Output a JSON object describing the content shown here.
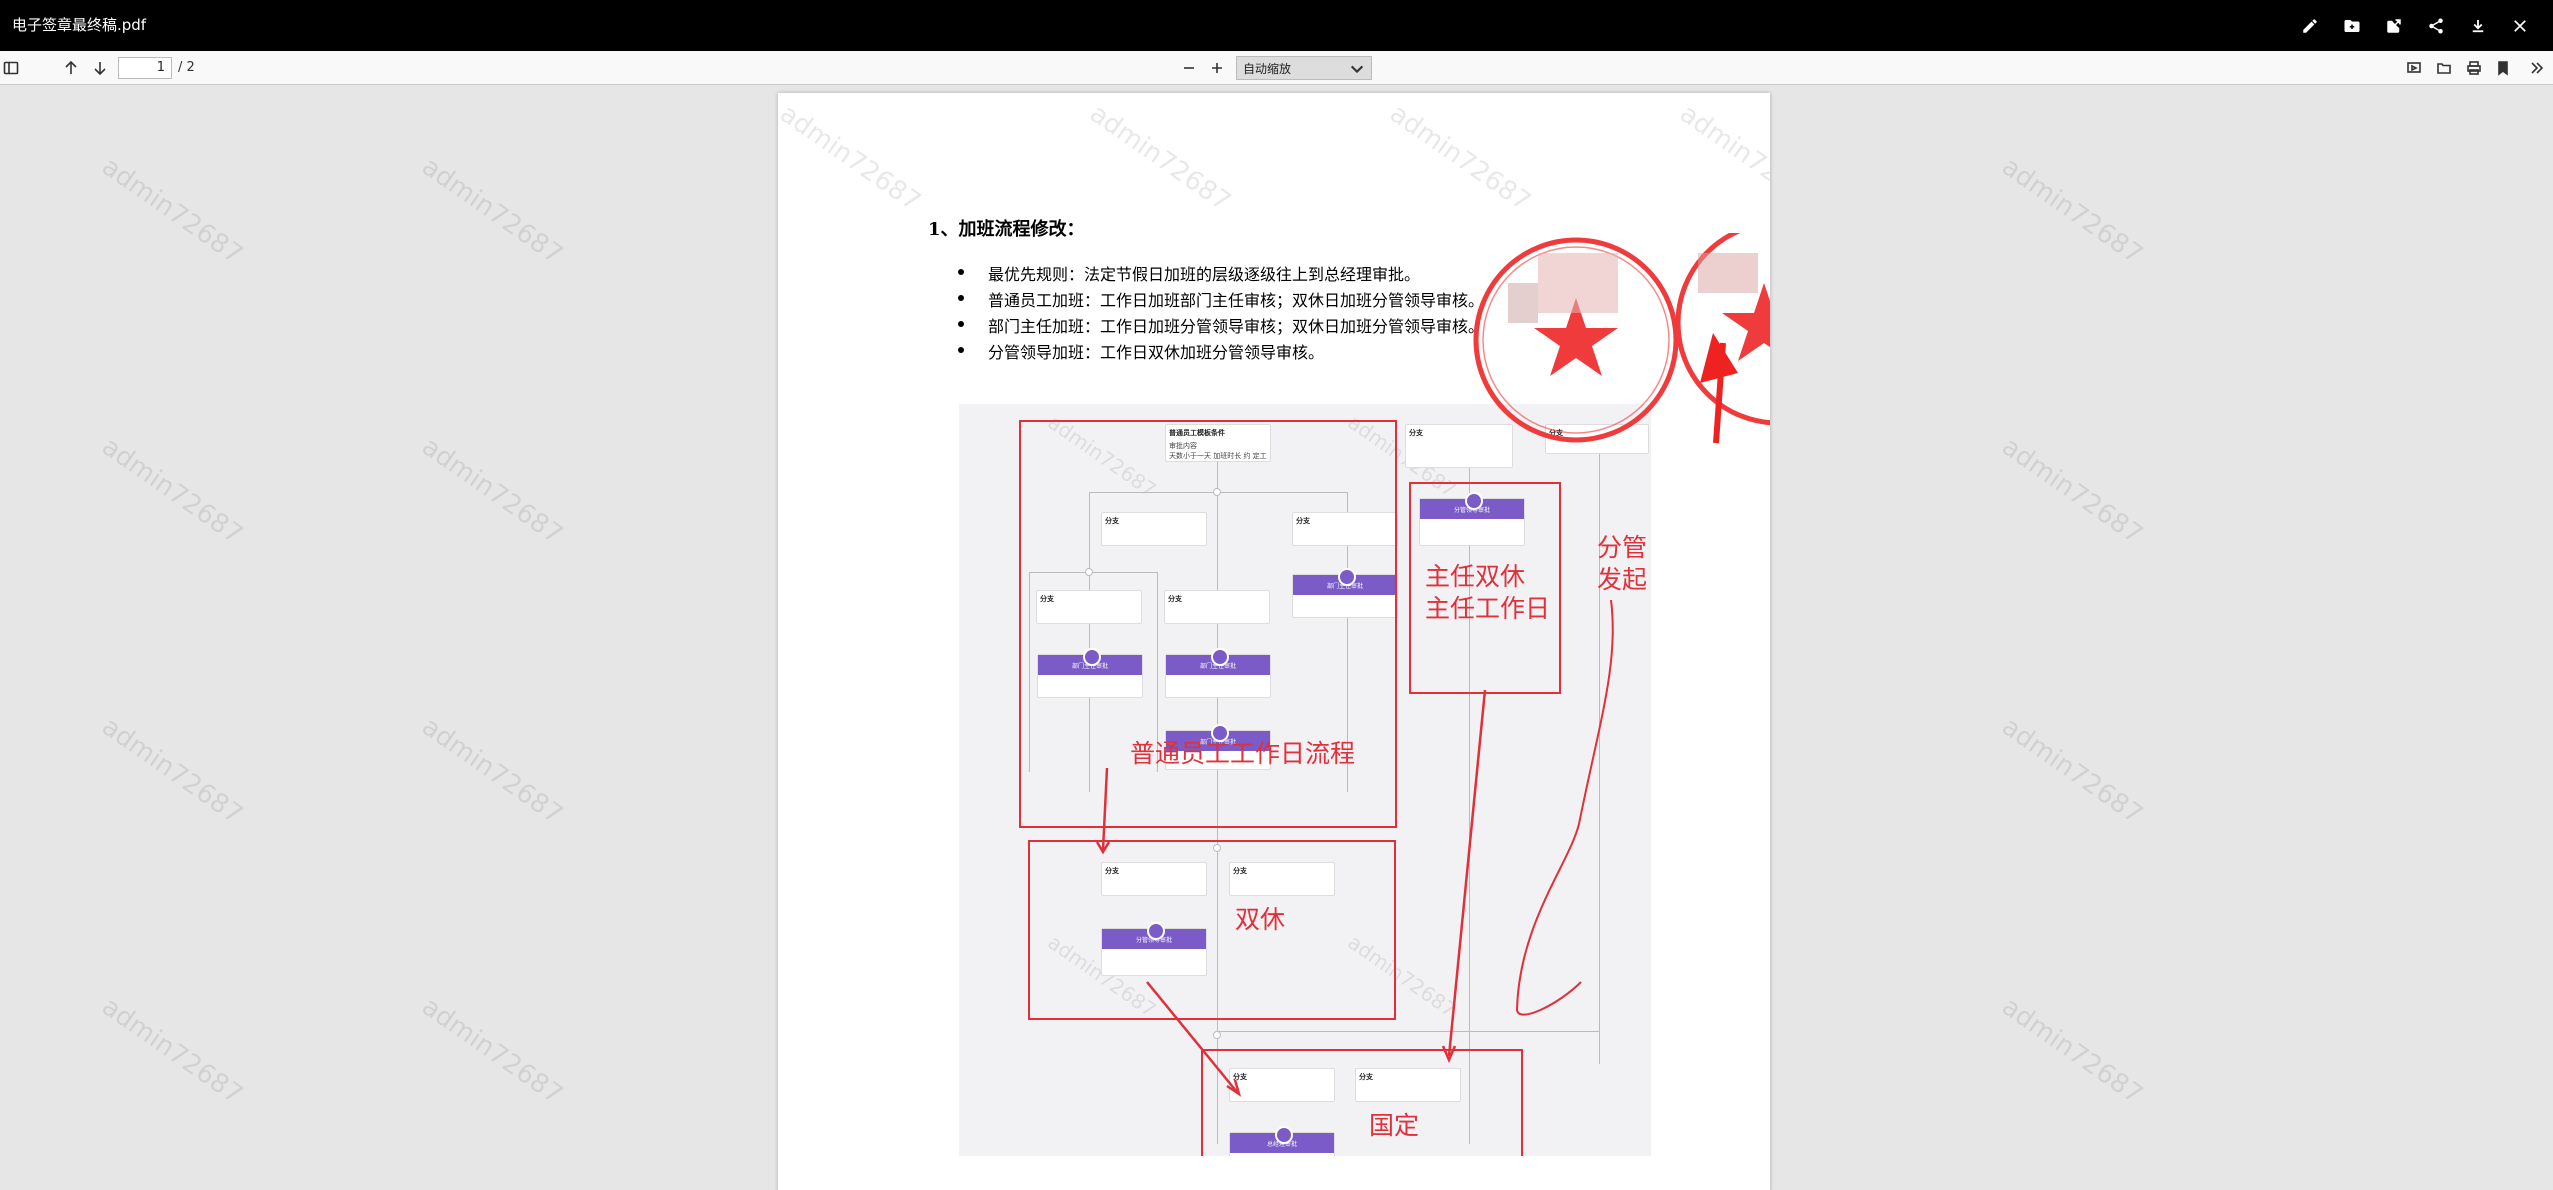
{
  "titlebar": {
    "filename": "电子签章最终稿.pdf",
    "icons": [
      "edit-icon",
      "save-to-folder-icon",
      "open-external-icon",
      "share-icon",
      "download-icon",
      "close-icon"
    ]
  },
  "toolbar": {
    "current_page": "1",
    "page_count": "/ 2",
    "zoom": "自动缩放",
    "icons": [
      "sidebar-toggle-icon",
      "previous-page-icon",
      "next-page-icon",
      "zoom-out-icon",
      "zoom-in-icon",
      "presentation-icon",
      "open-file-icon",
      "print-icon",
      "bookmark-icon",
      "more-tools-icon"
    ]
  },
  "document": {
    "heading": "1、加班流程修改：",
    "bullets": [
      "最优先规则：法定节假日加班的层级逐级往上到总经理审批。",
      "普通员工加班：工作日加班部门主任审核；双休日加班分管领导审核。",
      "部门主任加班：工作日加班分管领导审核；双休日加班分管领导审核。",
      "分管领导加班：工作日双休加班分管领导审核。"
    ],
    "watermark": "admin72687"
  },
  "diagram": {
    "start_node": {
      "title": "普通员工模板条件",
      "line1": "审批内容",
      "line2": "天数小于一天 加班时长 约 定工"
    },
    "branch_title": "分支",
    "approver_nodes": [
      "部门主任审批",
      "部门主任审批",
      "部门主任审批",
      "分管领导审批",
      "分管领导审批",
      "总经理审批"
    ],
    "annotations": {
      "normal_workday": "普通员工工作日流程",
      "director": "主任双休\n主任工作日",
      "weekend": "双休",
      "holiday": "国定",
      "leader": "分管\n发起"
    }
  },
  "colors": {
    "titlebar": "#000000",
    "approver_purple": "#7a5bc7",
    "annotation_red": "#e0303a",
    "stamp_red": "#ef3b3b"
  }
}
